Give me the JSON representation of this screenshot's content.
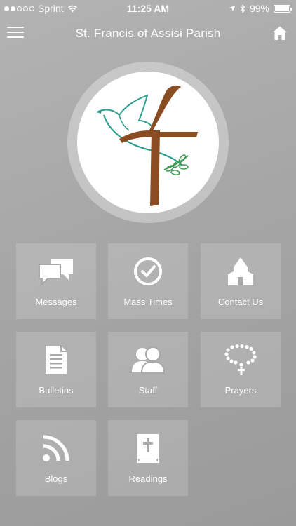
{
  "status_bar": {
    "carrier": "Sprint",
    "time": "11:25 AM",
    "battery": "99%",
    "battery_level": 0.99,
    "signal_bars_filled": 2,
    "signal_bars_total": 5
  },
  "nav": {
    "title": "St. Francis of Assisi Parish",
    "menu_icon": "hamburger-menu-icon",
    "home_icon": "home-icon"
  },
  "logo": {
    "icon": "dove-cross-logo",
    "colors": {
      "brown": "#8a4d22",
      "teal": "#2f9e8f",
      "green": "#3d9b55"
    }
  },
  "tiles": [
    {
      "label": "Messages",
      "icon": "chat-bubbles-icon"
    },
    {
      "label": "Mass Times",
      "icon": "clock-icon"
    },
    {
      "label": "Contact Us",
      "icon": "church-icon"
    },
    {
      "label": "Bulletins",
      "icon": "document-icon"
    },
    {
      "label": "Staff",
      "icon": "people-icon"
    },
    {
      "label": "Prayers",
      "icon": "rosary-icon"
    },
    {
      "label": "Blogs",
      "icon": "rss-icon"
    },
    {
      "label": "Readings",
      "icon": "bible-icon"
    }
  ]
}
